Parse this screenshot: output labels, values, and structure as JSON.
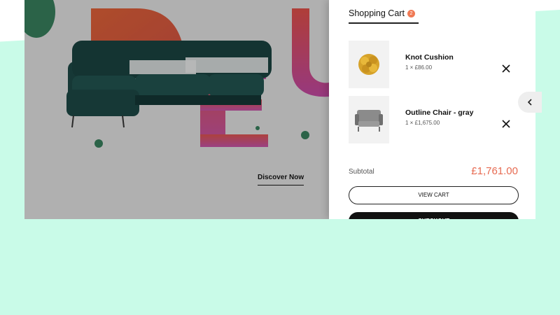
{
  "hero": {
    "cta_label": "Discover Now"
  },
  "cart": {
    "title": "Shopping Cart",
    "badge_count": "2",
    "items": [
      {
        "name": "Knot Cushion",
        "meta": "1 × £86.00",
        "icon": "knot-cushion-image"
      },
      {
        "name": "Outline Chair - gray",
        "meta": "1 × £1,675.00",
        "icon": "armchair-image"
      }
    ],
    "subtotal_label": "Subtotal",
    "subtotal_value": "£1,761.00",
    "view_cart_label": "VIEW CART",
    "checkout_label": "CHECKOUT"
  },
  "colors": {
    "accent": "#e76b52",
    "badge": "#f07a55",
    "mint_background": "#c9fbe8",
    "sofa": "#1f4e4b",
    "decor_green": "#3c8a64"
  }
}
